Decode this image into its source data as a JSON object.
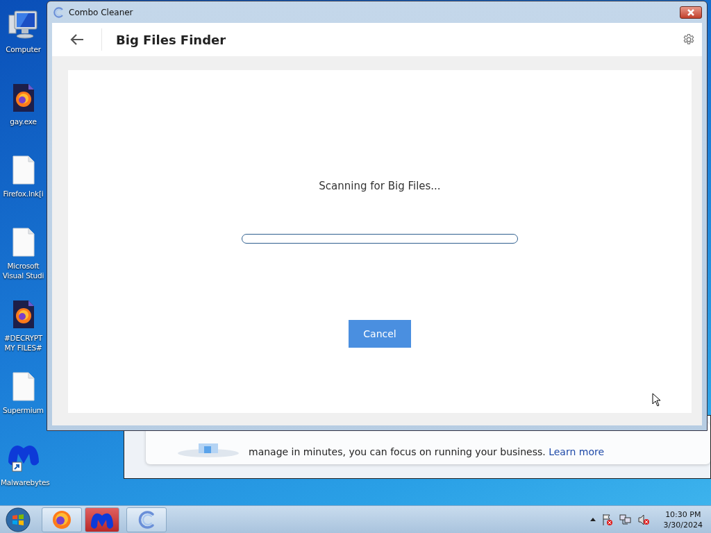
{
  "desktop_icons": [
    {
      "label": "Computer",
      "kind": "computer"
    },
    {
      "label": "gay.exe",
      "kind": "firefox"
    },
    {
      "label": "Firefox.lnk[i",
      "kind": "file"
    },
    {
      "label": "Microsoft Visual Studi",
      "kind": "file"
    },
    {
      "label": "#DECRYPT MY FILES#",
      "kind": "firefox"
    },
    {
      "label": "Supermium",
      "kind": "file"
    },
    {
      "label": "Malwarebytes",
      "kind": "malwarebytes"
    }
  ],
  "background_window": {
    "text": "manage in minutes, you can focus on running your business.",
    "link": "Learn more"
  },
  "window": {
    "title": "Combo Cleaner",
    "page_title": "Big Files Finder",
    "status": "Scanning for Big Files...",
    "progress": {
      "level": 0
    },
    "cancel_button": "Cancel"
  },
  "taskbar": {
    "items": [
      {
        "kind": "firefox"
      },
      {
        "kind": "malwarebytes"
      },
      {
        "kind": "combo"
      }
    ],
    "clock": {
      "time": "10:30 PM",
      "date": "3/30/2024"
    }
  }
}
